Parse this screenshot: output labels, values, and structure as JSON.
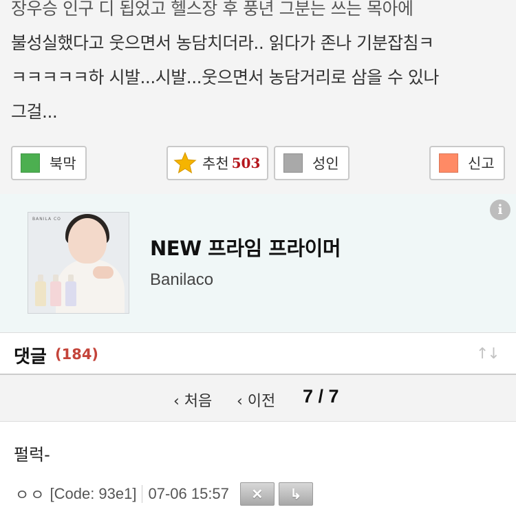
{
  "post": {
    "line1": "장우승 인구 디 됩었고 헬스장 후 풍년 그분는 쓰는 목아에",
    "line2": "불성실했다고 웃으면서 농담치더라.. 읽다가 존나 기분잡침ㅋ",
    "line3": "ㅋㅋㅋㅋㅋ하 시발...시발...웃으면서 농담거리로 삼을 수 있나",
    "line4": "그걸..."
  },
  "actions": {
    "block_label": "북막",
    "block_color": "#4caf50",
    "recommend_label": "추천",
    "recommend_count": "503",
    "adult_label": "성인",
    "adult_color": "#a9a9a9",
    "report_label": "신고",
    "report_color": "#ff8a65"
  },
  "ad": {
    "image_brand": "BANILA CO",
    "title": "NEW 프라임 프라이머",
    "brand": "Banilaco",
    "info_icon": "i"
  },
  "comments": {
    "title": "댓글",
    "count": "(184)",
    "sort_icon": "↑↓"
  },
  "pager": {
    "first": "‹ 처음",
    "prev": "‹ 이전",
    "current": "7 / 7"
  },
  "comment": {
    "text": "펄럭-",
    "user": "ㅇㅇ",
    "code": "[Code: 93e1]",
    "date": "07-06 15:57",
    "delete_icon": "✕",
    "reply_icon": "↳"
  }
}
